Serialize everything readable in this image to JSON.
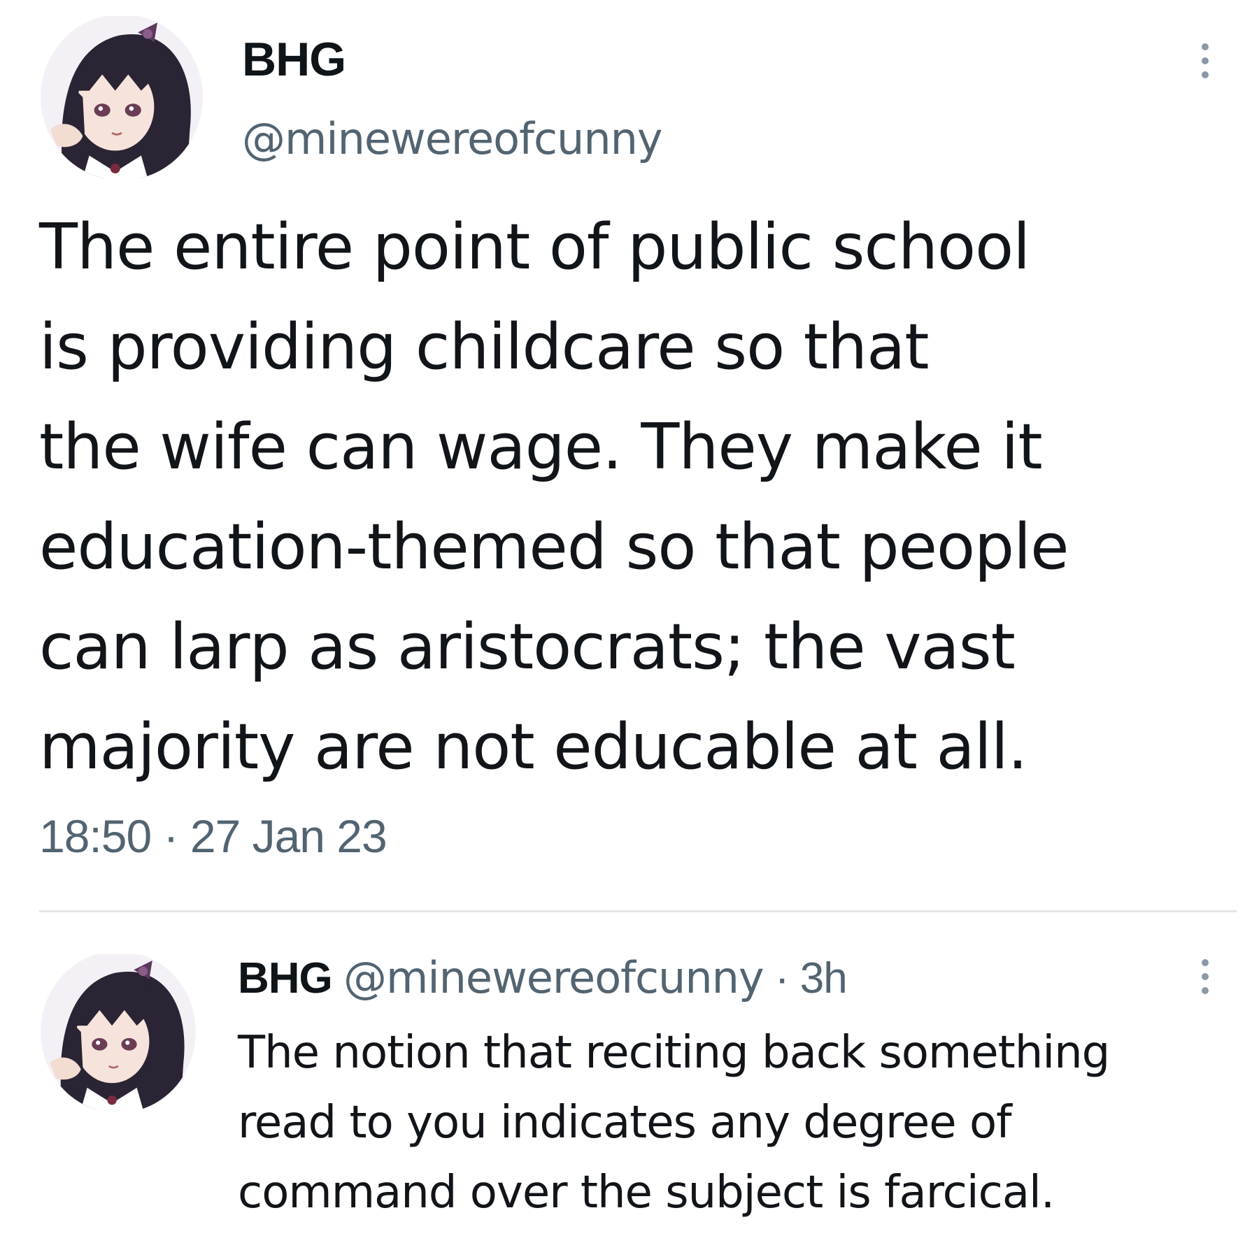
{
  "tweet": {
    "display_name": "BHG",
    "handle": "@minewereofcunny",
    "text": "The entire point of public school\nis providing childcare so that\nthe wife can wage. They make it\neducation-themed so that people\ncan larp as aristocrats; the vast\nmajority are not educable at all.",
    "timestamp": "18:50 · 27 Jan 23",
    "avatar_icon": "anime-girl-avatar",
    "more_icon": "vertical-ellipsis-icon"
  },
  "reply": {
    "display_name": "BHG",
    "handle": "@minewereofcunny",
    "separator": " · ",
    "age": "3h",
    "text": "The notion that reciting back something\nread to you indicates any degree of\ncommand over the subject is farcical.",
    "avatar_icon": "anime-girl-avatar",
    "more_icon": "vertical-ellipsis-icon"
  },
  "colors": {
    "text": "#0f1419",
    "secondary": "#536471",
    "divider": "#e4e6e8",
    "background": "#ffffff"
  }
}
